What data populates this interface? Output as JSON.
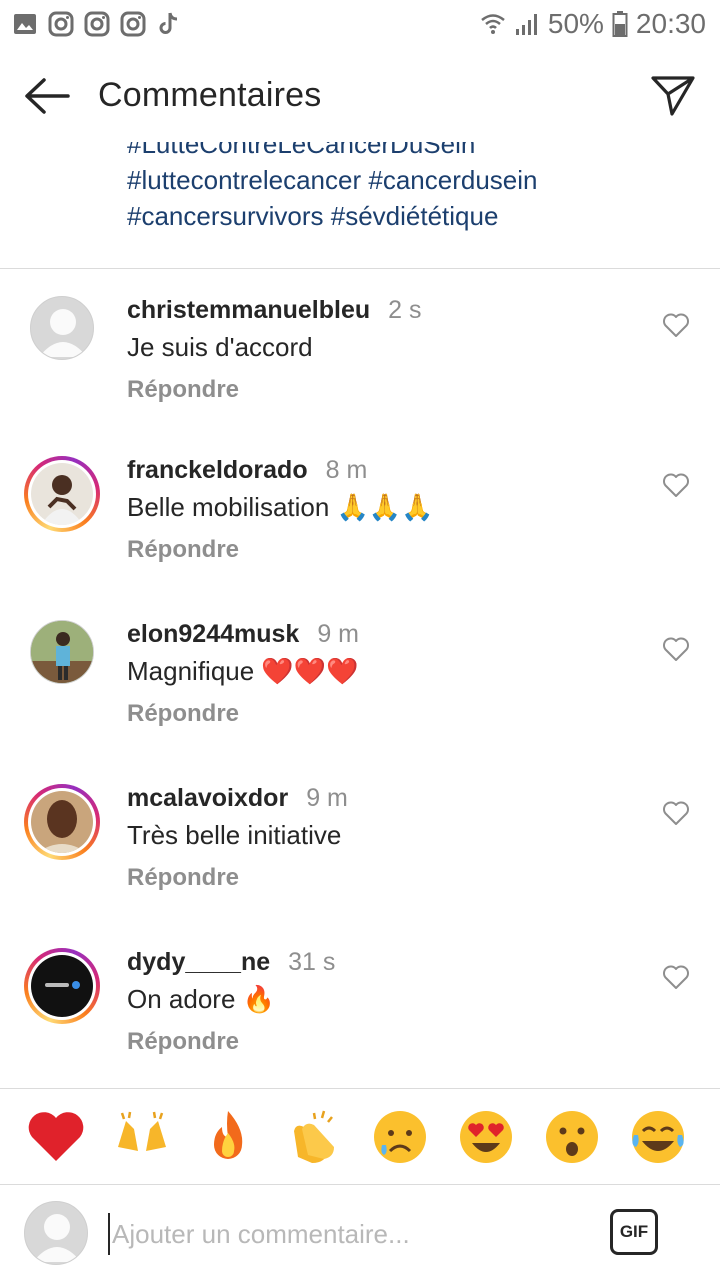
{
  "status_bar": {
    "battery": "50%",
    "time": "20:30",
    "icons": [
      "gallery-icon",
      "instagram-icon",
      "instagram-icon",
      "instagram-icon",
      "tiktok-icon",
      "wifi-icon",
      "signal-icon",
      "battery-icon"
    ]
  },
  "header": {
    "title": "Commentaires"
  },
  "caption": {
    "lines": [
      "#LutteContreLeCancerDuSein",
      "#luttecontrelecancer #cancerdusein",
      "#cancersurvivors #sévdiététique"
    ]
  },
  "comments": [
    {
      "username": "christemmanuelbleu",
      "time": "2 s",
      "text": "Je suis d'accord",
      "reply": "Répondre"
    },
    {
      "username": "franckeldorado",
      "time": "8 m",
      "text": "Belle mobilisation 🙏🙏🙏",
      "reply": "Répondre"
    },
    {
      "username": "elon9244musk",
      "time": "9 m",
      "text": "Magnifique ❤️❤️❤️",
      "reply": "Répondre"
    },
    {
      "username": "mcalavoixdor",
      "time": "9 m",
      "text": "Très belle initiative",
      "reply": "Répondre"
    },
    {
      "username": "dydy____ne",
      "time": "31 s",
      "text": "On adore 🔥",
      "reply": "Répondre"
    }
  ],
  "emoji_bar": [
    "heart",
    "raising-hands",
    "fire",
    "clapping-hands",
    "sad-face",
    "heart-eyes",
    "surprised-face",
    "tears-of-joy"
  ],
  "input": {
    "placeholder": "Ajouter un commentaire...",
    "gif_label": "GIF"
  },
  "colors": {
    "hashtag": "#1c3f6e",
    "secondary_text": "#8e8e8e",
    "divider": "#dbdbdb"
  }
}
